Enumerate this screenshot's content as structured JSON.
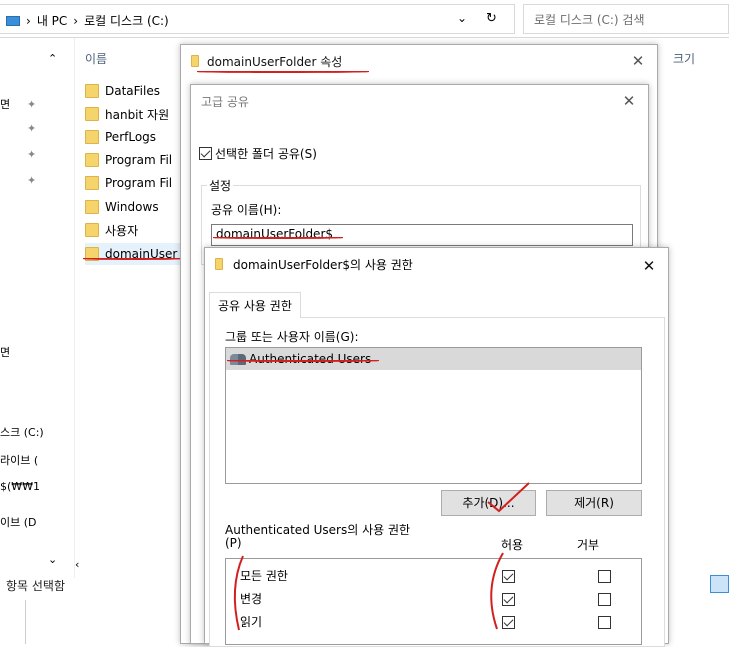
{
  "explorer": {
    "breadcrumb": [
      "내 PC",
      "로컬 디스크 (C:)"
    ],
    "search_placeholder": "로컬 디스크 (C:) 검색",
    "col_name": "이름",
    "col_size": "크기",
    "files": [
      "DataFiles",
      "hanbit 자원",
      "PerfLogs",
      "Program Fil",
      "Program Fil",
      "Windows",
      "사용자",
      "domainUser"
    ],
    "nav_items": [
      "스크 (C:)",
      "라이브 (",
      "$(₩₩1",
      "이브 (D"
    ],
    "status": "항목 선택함"
  },
  "properties_dialog": {
    "title": "domainUserFolder 속성"
  },
  "advanced_sharing": {
    "title": "고급 공유",
    "share_checkbox_label": "선택한 폴더 공유(S)",
    "share_checked": true,
    "settings_label": "설정",
    "share_name_label": "공유 이름(H):",
    "share_name_value": "domainUserFolder$"
  },
  "permissions_dialog": {
    "title": "domainUserFolder$의 사용 권한",
    "tab": "공유 사용 권한",
    "group_label": "그룹 또는 사용자 이름(G):",
    "users": [
      "Authenticated Users"
    ],
    "add_button": "추가(D)...",
    "remove_button": "제거(R)",
    "perm_label": "Authenticated Users의 사용 권한",
    "perm_label_p": "(P)",
    "allow_header": "허용",
    "deny_header": "거부",
    "permissions": [
      {
        "name": "모든 권한",
        "allow": true,
        "deny": false
      },
      {
        "name": "변경",
        "allow": true,
        "deny": false
      },
      {
        "name": "읽기",
        "allow": true,
        "deny": false
      }
    ]
  }
}
